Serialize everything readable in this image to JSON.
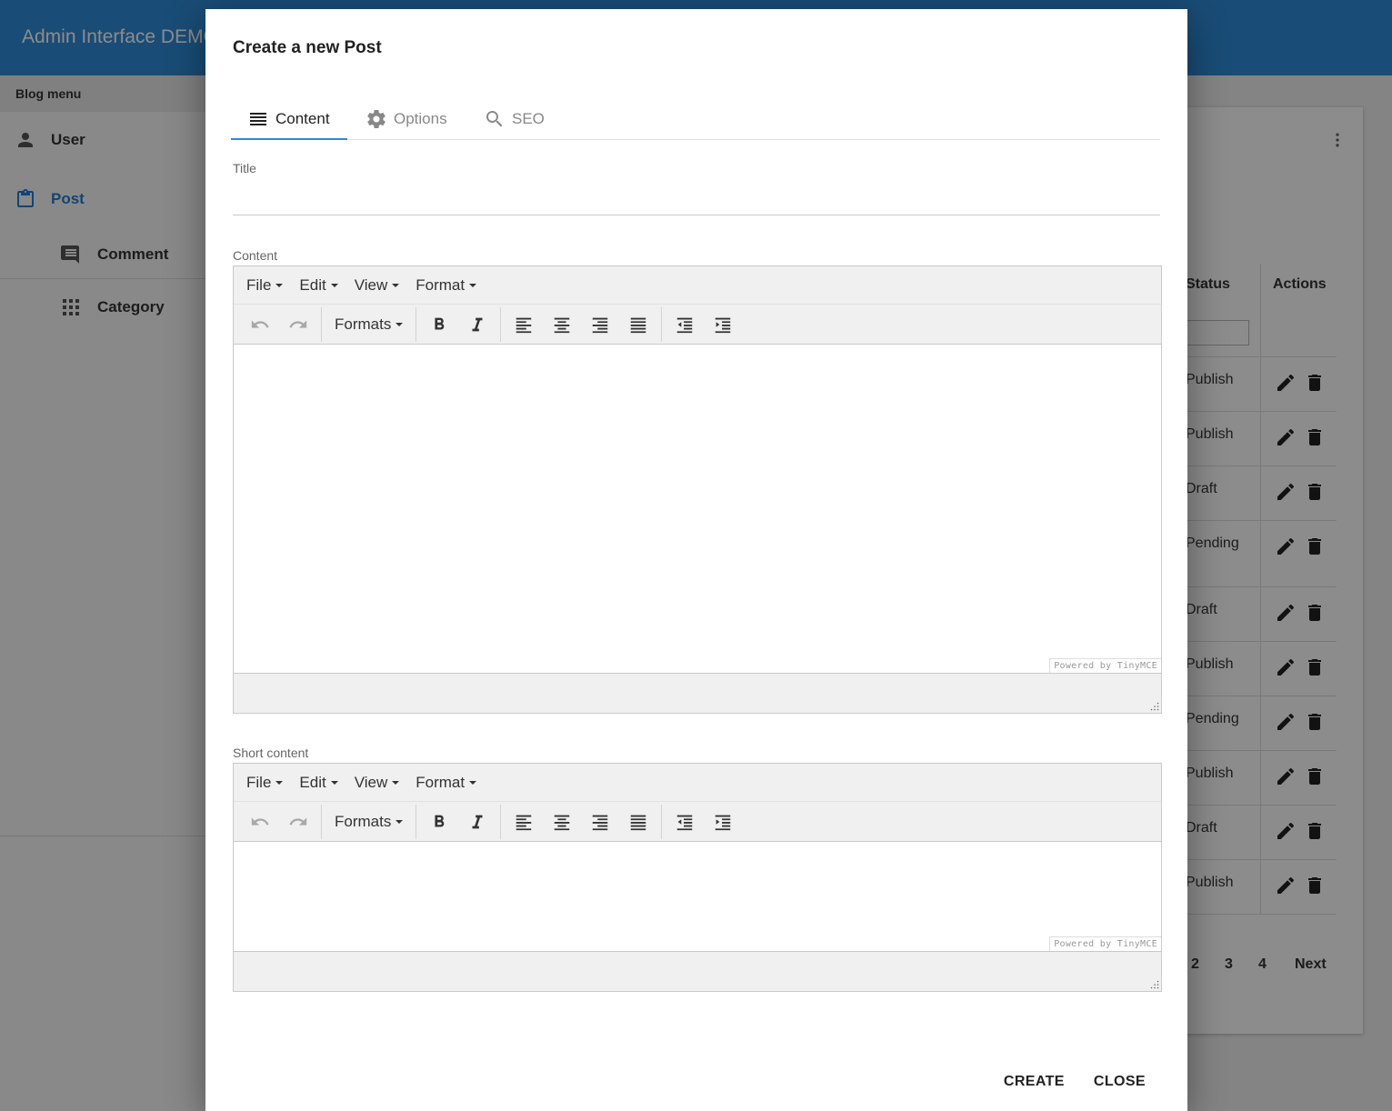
{
  "app": {
    "title": "Admin Interface DEMO"
  },
  "sidebar": {
    "heading": "Blog menu",
    "items": [
      {
        "label": "User",
        "icon": "person-icon",
        "active": false
      },
      {
        "label": "Post",
        "icon": "clipboard-icon",
        "active": true
      },
      {
        "label": "Comment",
        "icon": "comment-icon",
        "active": false
      },
      {
        "label": "Category",
        "icon": "grid-icon",
        "active": false
      }
    ]
  },
  "background_table": {
    "headers": {
      "status": "Status",
      "actions": "Actions"
    },
    "rows": [
      "Publish",
      "Publish",
      "Draft",
      "Pending",
      "Draft",
      "Publish",
      "Pending",
      "Publish",
      "Draft",
      "Publish"
    ],
    "pagination": [
      "2",
      "3",
      "4",
      "Next"
    ]
  },
  "dialog": {
    "title": "Create a new Post",
    "tabs": [
      {
        "label": "Content",
        "icon": "list-icon",
        "active": true
      },
      {
        "label": "Options",
        "icon": "gear-icon",
        "active": false
      },
      {
        "label": "SEO",
        "icon": "search-icon",
        "active": false
      }
    ],
    "fields": {
      "title_label": "Title",
      "title_value": "",
      "content_label": "Content",
      "short_content_label": "Short content"
    },
    "editor": {
      "menus": [
        "File",
        "Edit",
        "View",
        "Format"
      ],
      "formats_label": "Formats",
      "powered_by": "Powered by TinyMCE"
    },
    "actions": {
      "create": "CREATE",
      "close": "CLOSE"
    }
  },
  "colors": {
    "primary": "#2f8ad8",
    "active_nav": "#1e7fd6"
  }
}
